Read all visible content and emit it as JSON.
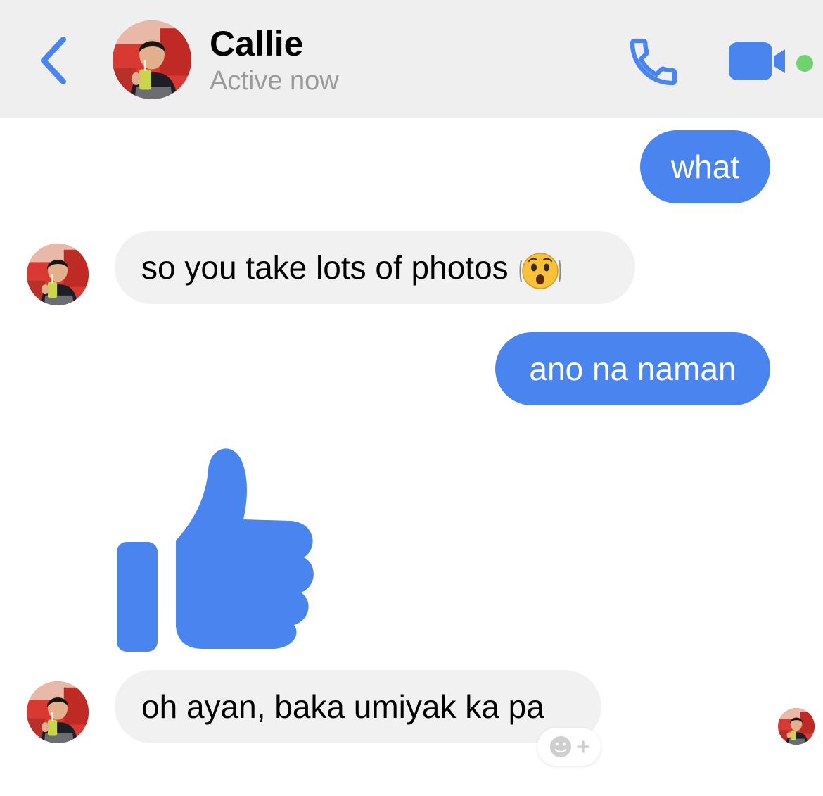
{
  "header": {
    "contact_name": "Callie",
    "status": "Active now"
  },
  "messages": [
    {
      "direction": "outgoing",
      "text": "what"
    },
    {
      "direction": "incoming",
      "text": "so you take lots of photos",
      "emoji": "hushed-face-emoji"
    },
    {
      "direction": "outgoing",
      "text": "ano na naman"
    },
    {
      "direction": "incoming",
      "type": "like-sticker",
      "icon": "thumbs-up-icon"
    },
    {
      "direction": "incoming",
      "text": "oh ayan, baka umiyak ka pa"
    }
  ],
  "icons": {
    "back": "chevron-left-icon",
    "call": "phone-icon",
    "video": "video-camera-icon",
    "reaction": "add-reaction-icon"
  },
  "colors": {
    "accent": "#4a84ee",
    "header_bg": "#efefef",
    "incoming_bg": "#f1f1f1",
    "active_dot": "#6fd26f",
    "status_text": "#9a9a9a"
  }
}
